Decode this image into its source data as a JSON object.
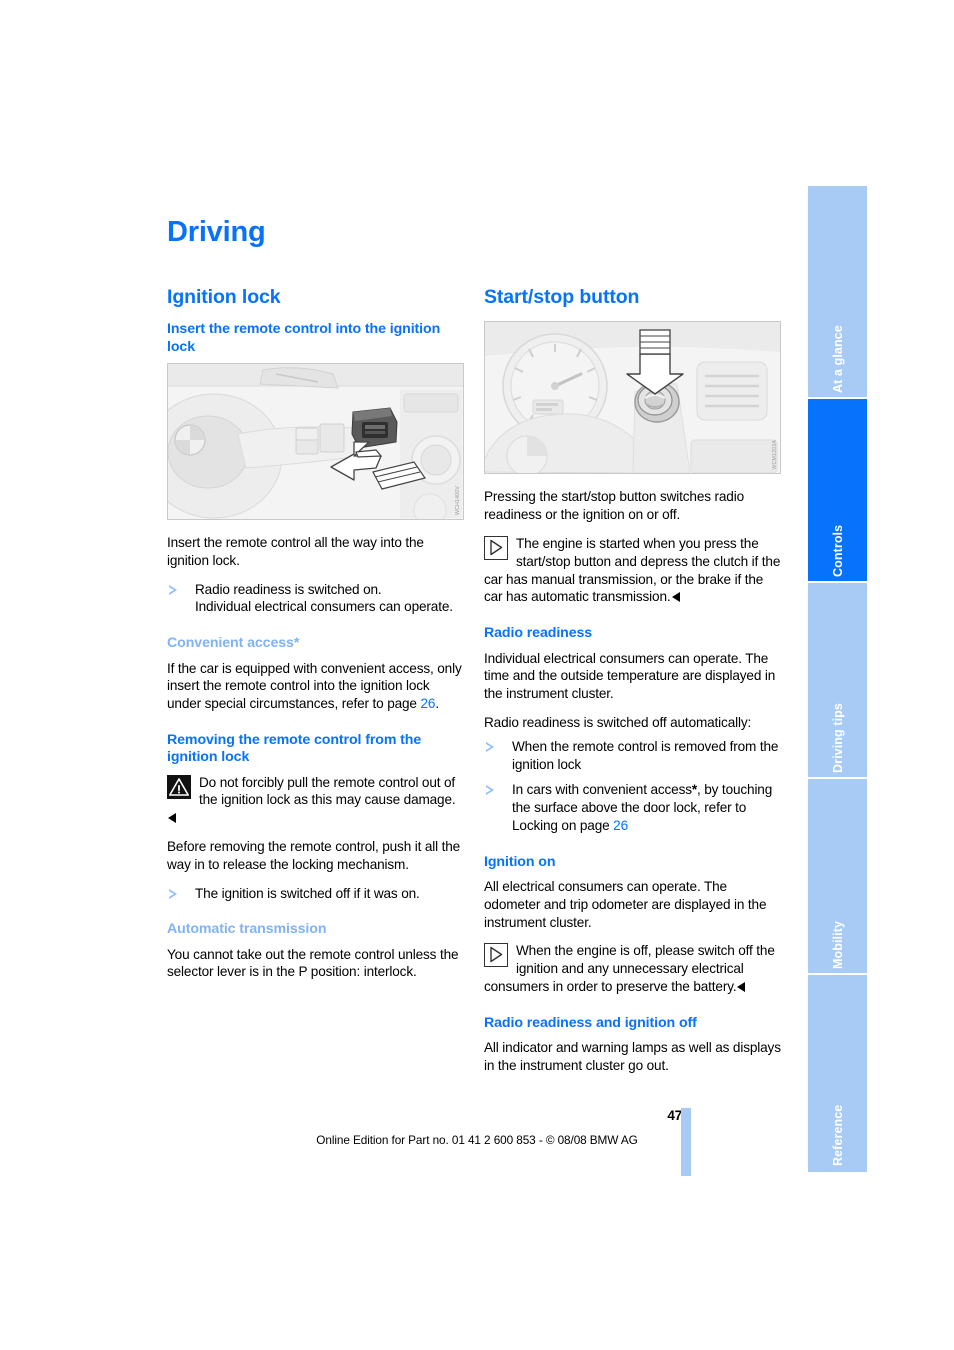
{
  "document": {
    "chapter_title": "Driving",
    "page_number": "47",
    "footer_text": "Online Edition for Part no. 01 41 2 600 853 - © 08/08 BMW AG"
  },
  "colors": {
    "heading_blue": "#0772FC",
    "light_blue": "#7FB3F5",
    "tab_inactive": "#A8CBF5",
    "tab_active": "#0772FC",
    "bullet_blue": "#8FBEF7"
  },
  "sidebar": {
    "tabs": [
      {
        "label": "At a glance",
        "active": false
      },
      {
        "label": "Controls",
        "active": true
      },
      {
        "label": "Driving tips",
        "active": false
      },
      {
        "label": "Mobility",
        "active": false
      },
      {
        "label": "Reference",
        "active": false
      }
    ]
  },
  "left_column": {
    "section_title": "Ignition lock",
    "sub1_title": "Insert the remote control into the ignition lock",
    "figure1_code": "WCH1400V",
    "para1": "Insert the remote control all the way into the ignition lock.",
    "bullet1_line1": "Radio readiness is switched on.",
    "bullet1_line2": "Individual electrical consumers can operate.",
    "sub2_title": "Convenient access*",
    "para2_part1": "If the car is equipped with convenient access, only insert the remote control into the ignition lock under special circumstances, refer to page ",
    "para2_pageref": "26",
    "para2_part2": ".",
    "sub3_title": "Removing the remote control from the ignition lock",
    "warning_text": "Do not forcibly pull the remote control out of the ignition lock as this may cause damage.",
    "para3": "Before removing the remote control, push it all the way in to release the locking mechanism.",
    "bullet2": "The ignition is switched off if it was on.",
    "sub4_title": "Automatic transmission",
    "para4": "You cannot take out the remote control unless the selector lever is in the P position: interlock."
  },
  "right_column": {
    "section_title": "Start/stop button",
    "figure2_code": "WCM1203A",
    "para1": "Pressing the start/stop button switches radio readiness or the ignition on or off.",
    "note1_text": "The engine is started when you press the start/stop button and depress the clutch if the car has manual transmission, or the brake if the car has automatic transmission.",
    "sub1_title": "Radio readiness",
    "para2": "Individual electrical consumers can operate. The time and the outside temperature are displayed in the instrument cluster.",
    "para3": "Radio readiness is switched off automatically:",
    "bullet1": "When the remote control is removed from the ignition lock",
    "bullet2_part1": "In cars with convenient access",
    "bullet2_star": "*",
    "bullet2_part2": ", by touching the surface above the door lock, refer to Locking on page ",
    "bullet2_pageref": "26",
    "sub2_title": "Ignition on",
    "para4": "All electrical consumers can operate. The odometer and trip odometer are displayed in the instrument cluster.",
    "note2_text": "When the engine is off, please switch off the ignition and any unnecessary electrical consumers in order to preserve the battery.",
    "sub3_title": "Radio readiness and ignition off",
    "para5": "All indicator and warning lamps as well as displays in the instrument cluster go out."
  }
}
